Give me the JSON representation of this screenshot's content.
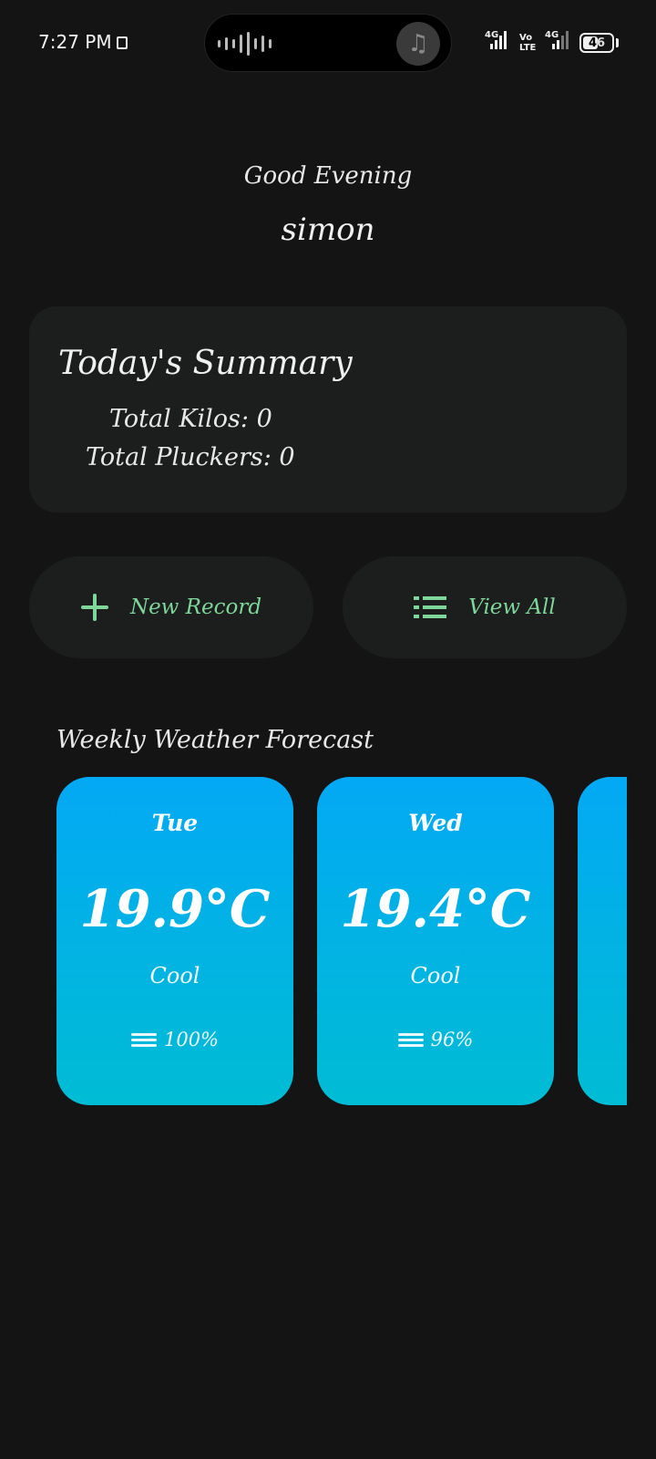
{
  "status_bar": {
    "time": "7:27 PM",
    "network1": "4G",
    "volte": "Vo LTE",
    "network2": "4G",
    "battery": "46"
  },
  "greeting": "Good Evening",
  "username": "simon",
  "summary": {
    "title": "Today's Summary",
    "total_kilos": "Total Kilos: 0",
    "total_pluckers": "Total Pluckers: 0"
  },
  "actions": {
    "new_record": "New Record",
    "view_all": "View All"
  },
  "weather": {
    "heading": "Weekly Weather Forecast",
    "days": [
      {
        "day": "Tue",
        "temp": "19.9°C",
        "desc": "Cool",
        "humidity": "100%"
      },
      {
        "day": "Wed",
        "temp": "19.4°C",
        "desc": "Cool",
        "humidity": "96%"
      }
    ],
    "card_gradient": [
      "#03a9f4",
      "#00bcd4"
    ]
  },
  "colors": {
    "background": "#141414",
    "card": "#1b1e1c",
    "accent": "#7fd69a"
  }
}
